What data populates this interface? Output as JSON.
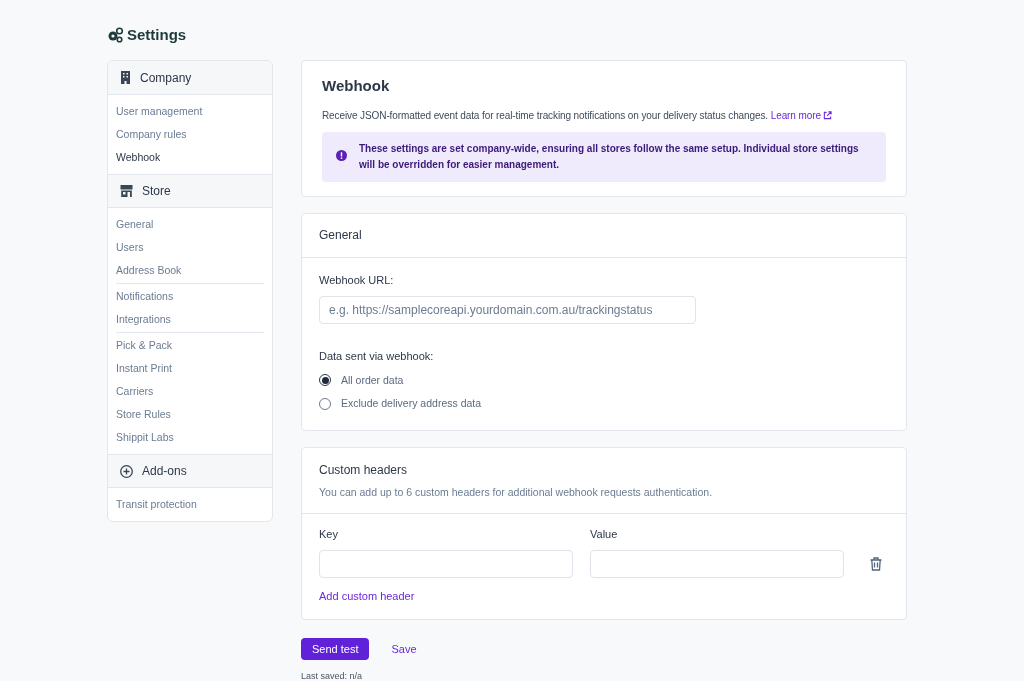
{
  "page_title": "Settings",
  "sidebar": [
    {
      "title": "Company",
      "groups": [
        [
          {
            "label": "User management",
            "selected": false
          },
          {
            "label": "Company rules",
            "selected": false
          },
          {
            "label": "Webhook",
            "selected": true
          }
        ]
      ]
    },
    {
      "title": "Store",
      "groups": [
        [
          {
            "label": "General",
            "selected": false
          },
          {
            "label": "Users",
            "selected": false
          },
          {
            "label": "Address Book",
            "selected": false
          }
        ],
        [
          {
            "label": "Notifications",
            "selected": false
          },
          {
            "label": "Integrations",
            "selected": false
          }
        ],
        [
          {
            "label": "Pick & Pack",
            "selected": false
          },
          {
            "label": "Instant Print",
            "selected": false
          },
          {
            "label": "Carriers",
            "selected": false
          },
          {
            "label": "Store Rules",
            "selected": false
          },
          {
            "label": "Shippit Labs",
            "selected": false
          }
        ]
      ]
    },
    {
      "title": "Add-ons",
      "groups": [
        [
          {
            "label": "Transit protection",
            "selected": false
          }
        ]
      ]
    }
  ],
  "intro": {
    "title": "Webhook",
    "description": "Receive JSON-formatted event data for real-time tracking notifications on your delivery status changes.",
    "link": "Learn more",
    "notice": "These settings are set company-wide, ensuring all stores follow the same setup. Individual store settings will be overridden for easier management."
  },
  "general": {
    "title": "General",
    "url_label": "Webhook URL:",
    "url_placeholder": "e.g. https://samplecoreapi.yourdomain.com.au/trackingstatus",
    "data_label": "Data sent via webhook:",
    "options": [
      {
        "label": "All order data",
        "selected": true
      },
      {
        "label": "Exclude delivery address data",
        "selected": false
      }
    ]
  },
  "custom_headers": {
    "title": "Custom headers",
    "description": "You can add up to 6 custom headers for additional webhook requests authentication.",
    "key_label": "Key",
    "value_label": "Value",
    "add_link": "Add custom header"
  },
  "actions": {
    "primary": "Send test",
    "secondary": "Save",
    "last_saved": "Last saved: n/a"
  }
}
